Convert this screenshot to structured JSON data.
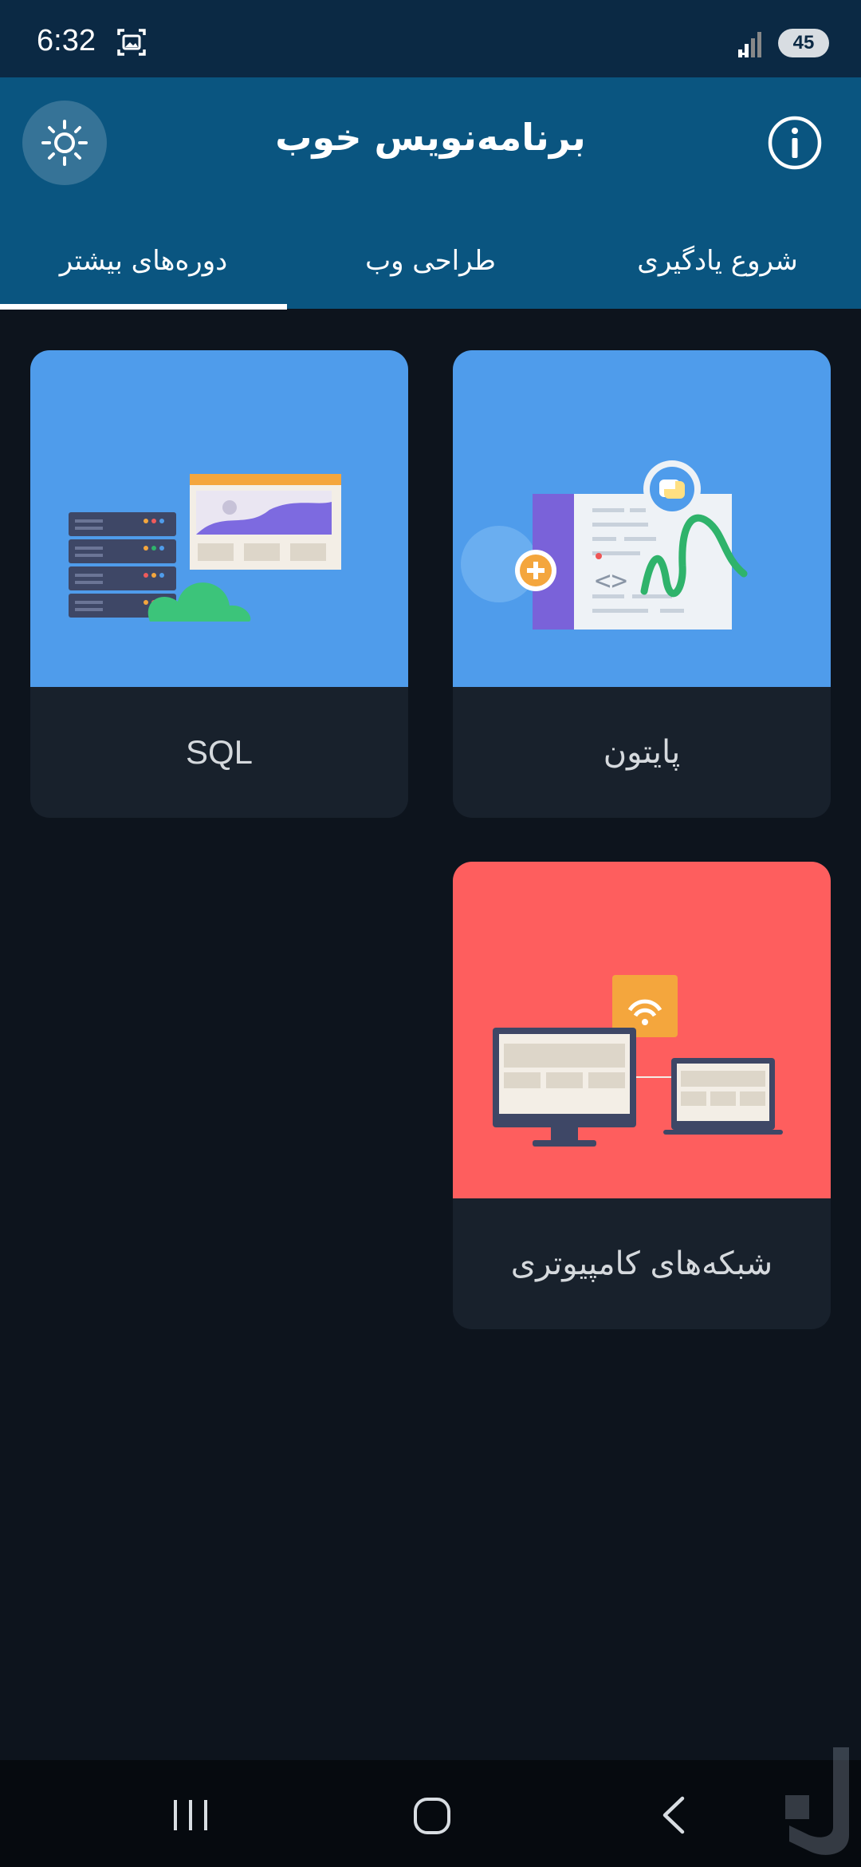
{
  "status_bar": {
    "time": "6:32",
    "battery": "45"
  },
  "header": {
    "title": "برنامه‌نویس خوب"
  },
  "tabs": [
    {
      "label": "شروع یادگیری"
    },
    {
      "label": "طراحی وب"
    },
    {
      "label": "دوره‌های بیشتر"
    }
  ],
  "active_tab": "دوره‌های بیشتر",
  "courses": [
    {
      "label": "پایتون",
      "color": "#4f9ceb"
    },
    {
      "label": "SQL",
      "color": "#4f9ceb"
    },
    {
      "label": "شبکه‌های کامپیوتری",
      "color": "#fe5e5e"
    }
  ],
  "colors": {
    "header": "#0a5580",
    "status_bar": "#0b2944",
    "background": "#0d141d",
    "card_footer": "#18212c"
  }
}
